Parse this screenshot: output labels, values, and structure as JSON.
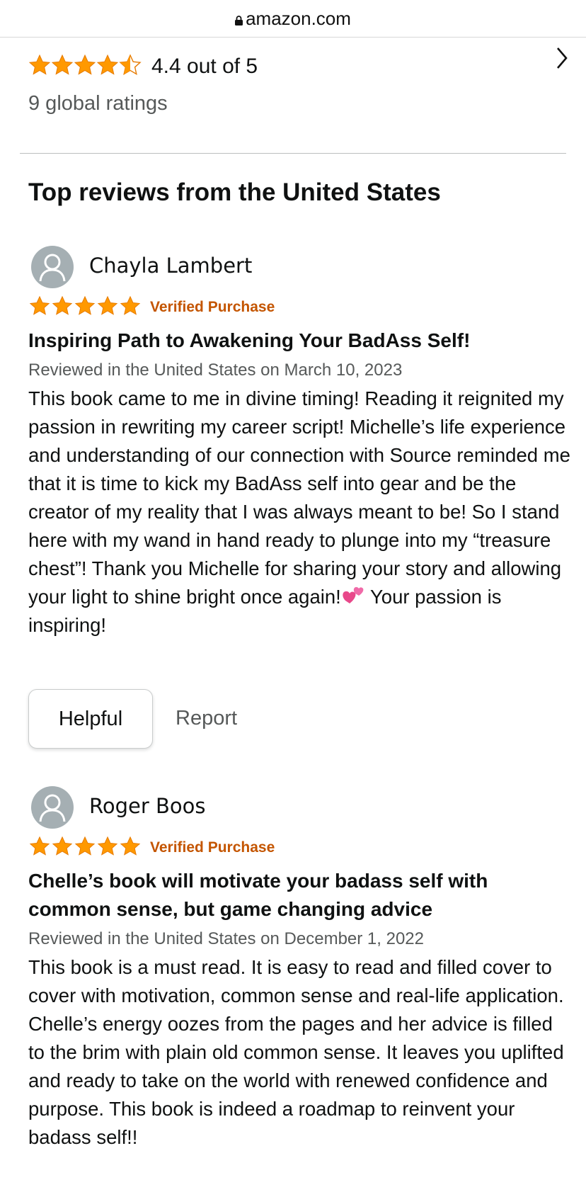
{
  "browser": {
    "url": "amazon.com",
    "lock_icon": "lock-icon"
  },
  "ratings_summary": {
    "rating": 4.4,
    "rating_text": "4.4 out of 5",
    "count_text": "9 global ratings",
    "star_color": "#ff9900"
  },
  "section": {
    "title": "Top reviews from the United States"
  },
  "reviews": [
    {
      "author": "Chayla Lambert",
      "stars": 5,
      "badge": "Verified Purchase",
      "title": "Inspiring Path to Awakening Your BadAss Self!",
      "date_line": "Reviewed in the United States on March 10, 2023",
      "body": "This book came to me in divine timing! Reading it reignited my passion in rewriting my career script! Michelle’s life experience and understanding of our connection with Source reminded me that it is time to kick my BadAss self into gear and be the creator of my reality that I was always meant to be! So I stand here with my wand in hand ready to plunge into my “treasure chest”! Thank you Michelle for sharing your story and allowing your light to shine bright once again!",
      "body_tail": " Your passion is inspiring!",
      "helpful_label": "Helpful",
      "report_label": "Report"
    },
    {
      "author": "Roger Boos",
      "stars": 5,
      "badge": "Verified Purchase",
      "title": "Chelle’s book will motivate your badass self with common sense, but game changing advice",
      "date_line": "Reviewed in the United States on December 1, 2022",
      "body": "This book is a must read. It is easy to read and filled cover to cover with motivation, common sense and real-life application. Chelle’s energy oozes from the pages and her advice is filled to the brim with plain old common sense. It leaves you uplifted and ready to take on the world with renewed confidence and purpose. This book is indeed a roadmap to reinvent your badass self!!"
    }
  ],
  "colors": {
    "badge": "#c45500",
    "muted_text": "#565959",
    "avatar_bg": "#a5afb3"
  }
}
